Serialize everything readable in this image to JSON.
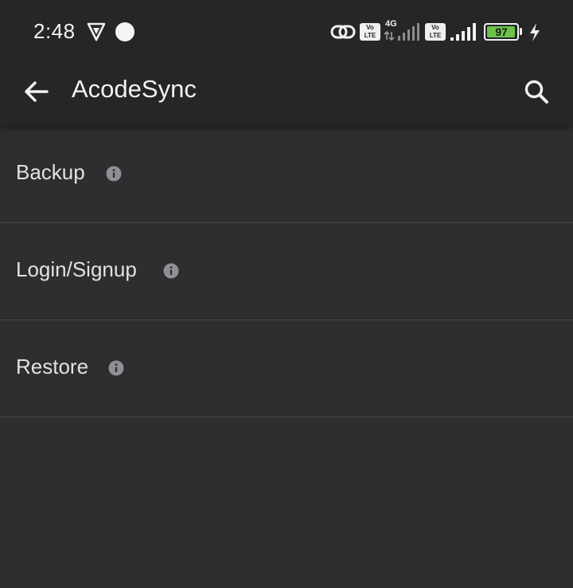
{
  "status_bar": {
    "time": "2:48",
    "network_type": "4G",
    "volte_label_top": "Vo",
    "volte_label_bottom": "LTE",
    "battery_level": "97",
    "battery_percent": 97,
    "battery_color": "#6cc24a",
    "icons": [
      "vpn-icon",
      "notification-dot-icon",
      "link-icon",
      "volte-icon",
      "signal-icon",
      "battery-icon",
      "charging-icon"
    ]
  },
  "appbar": {
    "title": "AcodeSync",
    "back_icon": "arrow-left-icon",
    "search_icon": "search-icon"
  },
  "settings": {
    "items": [
      {
        "label": "Backup",
        "icon": "info-icon"
      },
      {
        "label": "Login/Signup",
        "icon": "info-icon"
      },
      {
        "label": "Restore",
        "icon": "info-icon"
      }
    ]
  },
  "colors": {
    "background": "#2c2e30",
    "header": "#242628",
    "divider": "#45484b",
    "text": "#e2e2e2",
    "icon_muted": "#8e9094"
  }
}
